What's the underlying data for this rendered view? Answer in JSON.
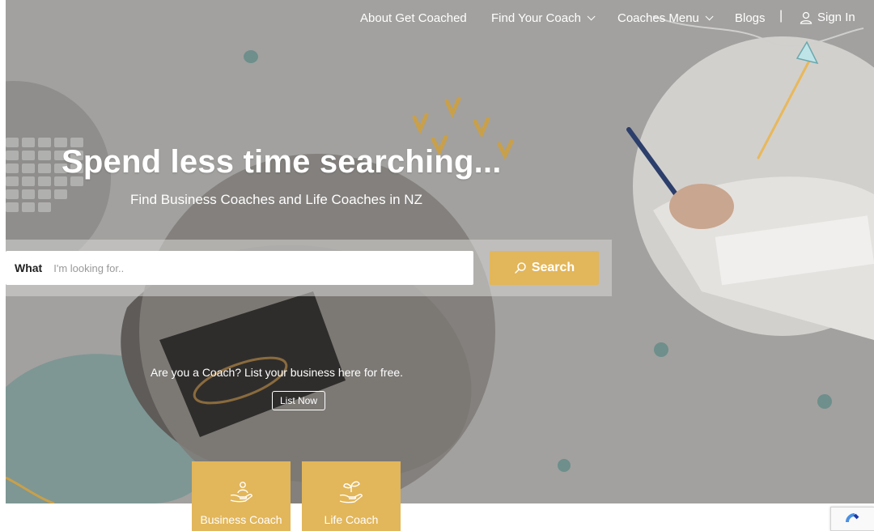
{
  "nav": {
    "about": "About Get Coached",
    "find_coach": "Find Your Coach",
    "coaches_menu": "Coaches Menu",
    "blogs": "Blogs",
    "separator": "|",
    "sign_in": "Sign In"
  },
  "hero": {
    "headline": "Spend less time searching...",
    "subheadline": "Find Business Coaches and Life Coaches in NZ"
  },
  "search": {
    "label": "What",
    "placeholder": "I'm looking for..",
    "button_label": "Search"
  },
  "coach_cta": {
    "text": "Are you a Coach? List your business here for free.",
    "button_label": "List Now"
  },
  "categories": [
    {
      "label": "Business Coach",
      "icon": "hand-person-icon"
    },
    {
      "label": "Life Coach",
      "icon": "hand-plant-icon"
    }
  ],
  "colors": {
    "accent": "#e2b65a",
    "overlay": "#9b9a98",
    "teal": "#7aa39e",
    "annotation_arrow": "#e8b85a"
  }
}
